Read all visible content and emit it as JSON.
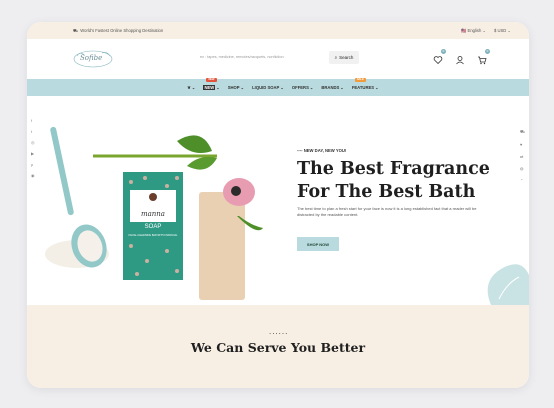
{
  "topbar": {
    "tagline": "World's Fastest Online Shopping Destination",
    "language": "English",
    "currency": "USD"
  },
  "header": {
    "logo_text": "Sofibe",
    "search_placeholder": "ex : tapes, medicine, remotes/racquets, nonfiction",
    "search_button": "Search",
    "wishlist_count": "0",
    "cart_count": "0"
  },
  "nav": {
    "items": [
      {
        "label": "",
        "icon": "leaf-icon"
      },
      {
        "label": "NEW",
        "tag": ""
      },
      {
        "label": "SHOP"
      },
      {
        "label": "LIQUID SOAP"
      },
      {
        "label": "OFFERS"
      },
      {
        "label": "BRANDS"
      },
      {
        "label": "FEATURES"
      }
    ],
    "tag_new": "NEW",
    "tag_sale": "SALE"
  },
  "hero": {
    "subtitle": "---- NEW DAY, NEW YOU!",
    "title_line1": "The Best Fragrance",
    "title_line2": "For The Best Bath",
    "description": "The best time to plan a fresh start for your face is now it is a long established fact that a reader will be distracted by the readable content.",
    "button": "SHOP NOW",
    "soap_brand": "manna",
    "soap_label": "SOAP",
    "soap_sub": "FACIAL CLEANSING BAR WITH CHARCOAL"
  },
  "services": {
    "dots": "......",
    "title": "We Can Serve You Better"
  },
  "colors": {
    "accent": "#b9dade",
    "cream": "#f8efe4",
    "soap_box": "#2f9a84"
  }
}
